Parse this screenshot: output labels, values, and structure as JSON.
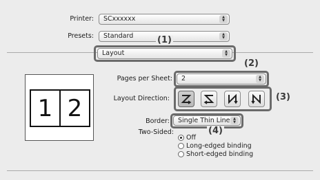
{
  "printer": {
    "label": "Printer:",
    "value": "SCxxxxxx"
  },
  "presets": {
    "label": "Presets:",
    "value": "Standard"
  },
  "panel": {
    "value": "Layout"
  },
  "pages_per_sheet": {
    "label": "Pages per Sheet:",
    "value": "2"
  },
  "layout_direction": {
    "label": "Layout Direction:",
    "options": [
      "Z",
      "S",
      "N",
      "N"
    ],
    "selected_index": 0
  },
  "border": {
    "label": "Border:",
    "value": "Single Thin Line"
  },
  "two_sided": {
    "label": "Two-Sided:",
    "options": [
      "Off",
      "Long-edged binding",
      "Short-edged binding"
    ],
    "selected": "Off"
  },
  "preview": {
    "pages": [
      "1",
      "2"
    ]
  },
  "callouts": {
    "c1": "(1)",
    "c2": "(2)",
    "c3": "(3)",
    "c4": "(4)"
  },
  "icons": {
    "stepper": "up-down-arrows-icon",
    "layout_dir": "z-order-arrow-icons"
  }
}
